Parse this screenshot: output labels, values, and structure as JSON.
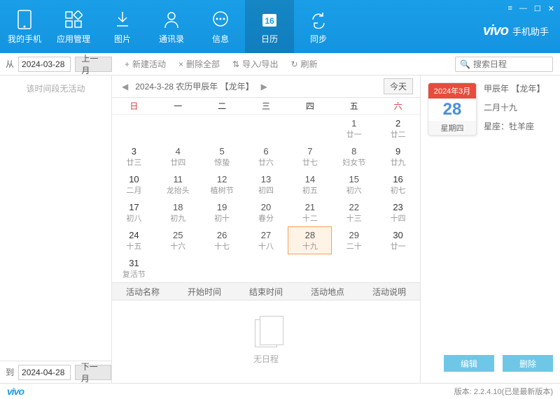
{
  "nav": [
    {
      "label": "我的手机"
    },
    {
      "label": "应用管理"
    },
    {
      "label": "图片"
    },
    {
      "label": "通讯录"
    },
    {
      "label": "信息"
    },
    {
      "label": "日历"
    },
    {
      "label": "同步"
    }
  ],
  "brand": {
    "logo": "vivo",
    "text": "手机助手"
  },
  "toolbar": {
    "from_label": "从",
    "to_label": "到",
    "from_date": "2024-03-28",
    "to_date": "2024-04-28",
    "prev_month": "上一月",
    "next_month": "下一月",
    "new_activity": "新建活动",
    "delete_all": "删除全部",
    "import_export": "导入/导出",
    "refresh": "刷新",
    "search_placeholder": "搜索日程"
  },
  "sidebar": {
    "empty_text": "该时间段无活动"
  },
  "calendar": {
    "title": "2024-3-28  农历甲辰年 【龙年】",
    "today_btn": "今天",
    "weekdays": [
      "日",
      "一",
      "二",
      "三",
      "四",
      "五",
      "六"
    ],
    "cells": [
      {
        "num": "",
        "label": ""
      },
      {
        "num": "",
        "label": ""
      },
      {
        "num": "",
        "label": ""
      },
      {
        "num": "",
        "label": ""
      },
      {
        "num": "",
        "label": ""
      },
      {
        "num": "1",
        "label": "廿一"
      },
      {
        "num": "2",
        "label": "廿二"
      },
      {
        "num": "3",
        "label": "廿三"
      },
      {
        "num": "4",
        "label": "廿四"
      },
      {
        "num": "5",
        "label": "惊蛰"
      },
      {
        "num": "6",
        "label": "廿六"
      },
      {
        "num": "7",
        "label": "廿七"
      },
      {
        "num": "8",
        "label": "妇女节"
      },
      {
        "num": "9",
        "label": "廿九"
      },
      {
        "num": "10",
        "label": "二月"
      },
      {
        "num": "11",
        "label": "龙抬头"
      },
      {
        "num": "12",
        "label": "植树节"
      },
      {
        "num": "13",
        "label": "初四"
      },
      {
        "num": "14",
        "label": "初五"
      },
      {
        "num": "15",
        "label": "初六"
      },
      {
        "num": "16",
        "label": "初七"
      },
      {
        "num": "17",
        "label": "初八"
      },
      {
        "num": "18",
        "label": "初九"
      },
      {
        "num": "19",
        "label": "初十"
      },
      {
        "num": "20",
        "label": "春分"
      },
      {
        "num": "21",
        "label": "十二"
      },
      {
        "num": "22",
        "label": "十三"
      },
      {
        "num": "23",
        "label": "十四"
      },
      {
        "num": "24",
        "label": "十五"
      },
      {
        "num": "25",
        "label": "十六"
      },
      {
        "num": "26",
        "label": "十七"
      },
      {
        "num": "27",
        "label": "十八"
      },
      {
        "num": "28",
        "label": "十九",
        "today": true
      },
      {
        "num": "29",
        "label": "二十"
      },
      {
        "num": "30",
        "label": "廿一"
      },
      {
        "num": "31",
        "label": "复活节"
      },
      {
        "num": "",
        "label": ""
      },
      {
        "num": "",
        "label": ""
      },
      {
        "num": "",
        "label": ""
      },
      {
        "num": "",
        "label": ""
      },
      {
        "num": "",
        "label": ""
      },
      {
        "num": "",
        "label": ""
      }
    ],
    "activity_cols": [
      "活动名称",
      "开始时间",
      "结束时间",
      "活动地点",
      "活动说明"
    ],
    "no_schedule": "无日程"
  },
  "rightpane": {
    "card_head": "2024年3月",
    "card_day": "28",
    "card_week": "星期四",
    "year_label": "甲辰年 【龙年】",
    "lunar_day": "二月十九",
    "zodiac_label": "星座：",
    "zodiac": "牡羊座",
    "edit": "编辑",
    "delete": "删除"
  },
  "status": {
    "logo": "vivo",
    "version": "版本: 2.2.4.10(已是最新版本)"
  }
}
